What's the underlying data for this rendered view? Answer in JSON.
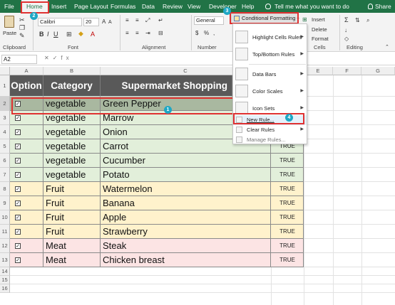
{
  "tabs": [
    "File",
    "Home",
    "Insert",
    "Page Layout",
    "Formulas",
    "Data",
    "Review",
    "View",
    "Developer",
    "Help"
  ],
  "tell_me": "Tell me what you want to do",
  "share_label": "Share",
  "ribbon": {
    "paste": "Paste",
    "clipboard": "Clipboard",
    "font_name": "Calibri",
    "font_size": "20",
    "font": "Font",
    "alignment": "Alignment",
    "number_format": "General",
    "number": "Number",
    "conditional_formatting": "Conditional Formatting",
    "insert": "Insert",
    "delete": "Delete",
    "format": "Format",
    "cells": "Cells",
    "editing": "Editing"
  },
  "name_box": "A2",
  "columns": [
    "A",
    "B",
    "C",
    "D",
    "E",
    "F",
    "G"
  ],
  "rows": [
    "1",
    "2",
    "3",
    "4",
    "5",
    "6",
    "7",
    "8",
    "9",
    "10",
    "11",
    "12",
    "13",
    "14",
    "15",
    "16"
  ],
  "headers": {
    "option": "Option",
    "category": "Category",
    "item": "Supermarket Shopping"
  },
  "data_rows": [
    {
      "checked": true,
      "category": "vegetable",
      "item": "Green Pepper",
      "flag": ""
    },
    {
      "checked": true,
      "category": "vegetable",
      "item": "Marrow",
      "flag": ""
    },
    {
      "checked": true,
      "category": "vegetable",
      "item": "Onion",
      "flag": ""
    },
    {
      "checked": true,
      "category": "vegetable",
      "item": "Carrot",
      "flag": "TRUE"
    },
    {
      "checked": true,
      "category": "vegetable",
      "item": "Cucumber",
      "flag": "TRUE"
    },
    {
      "checked": true,
      "category": "vegetable",
      "item": "Potato",
      "flag": "TRUE"
    },
    {
      "checked": true,
      "category": "Fruit",
      "item": "Watermelon",
      "flag": "TRUE"
    },
    {
      "checked": true,
      "category": "Fruit",
      "item": "Banana",
      "flag": "TRUE"
    },
    {
      "checked": true,
      "category": "Fruit",
      "item": "Apple",
      "flag": "TRUE"
    },
    {
      "checked": true,
      "category": "Fruit",
      "item": "Strawberry",
      "flag": "TRUE"
    },
    {
      "checked": true,
      "category": "Meat",
      "item": "Steak",
      "flag": "TRUE"
    },
    {
      "checked": true,
      "category": "Meat",
      "item": "Chicken breast",
      "flag": "TRUE"
    }
  ],
  "category_colors": {
    "vegetable": "#e2efda",
    "Fruit": "#fff2cc",
    "Meat": "#fce4e4",
    "selected": "#a9b8a0"
  },
  "menu": {
    "items": [
      "Highlight Cells Rules",
      "Top/Bottom Rules",
      "Data Bars",
      "Color Scales",
      "Icon Sets"
    ],
    "new_rule": "New Rule...",
    "clear_rules": "Clear Rules",
    "manage_rules": "Manage Rules..."
  },
  "badges": [
    "1",
    "2",
    "3",
    "4"
  ],
  "checkmark": "✓"
}
